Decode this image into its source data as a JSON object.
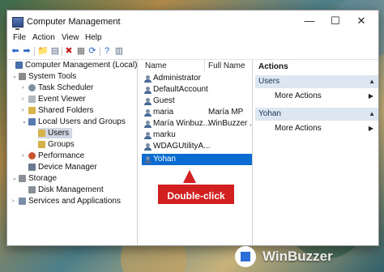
{
  "window": {
    "title": "Computer Management",
    "controls": {
      "minimize": "—",
      "maximize": "☐",
      "close": "✕"
    }
  },
  "menu": [
    "File",
    "Action",
    "View",
    "Help"
  ],
  "toolbar": [
    "⬅",
    "➡",
    "📁",
    "▤",
    "✖",
    "▦",
    "⟳",
    "?",
    "▥"
  ],
  "tree_expand": {
    "expanded": "⌄",
    "collapsed": "›"
  },
  "tree": [
    "Computer Management (Local)",
    "System Tools",
    "Task Scheduler",
    "Event Viewer",
    "Shared Folders",
    "Local Users and Groups",
    "Users",
    "Groups",
    "Performance",
    "Device Manager",
    "Storage",
    "Disk Management",
    "Services and Applications"
  ],
  "list": {
    "columns": [
      "Name",
      "Full Name"
    ],
    "rows": [
      {
        "name": "Administrator",
        "full": ""
      },
      {
        "name": "DefaultAccount",
        "full": ""
      },
      {
        "name": "Guest",
        "full": ""
      },
      {
        "name": "maria",
        "full": "María MP"
      },
      {
        "name": "María Winbuz...",
        "full": "WinBuzzer ..."
      },
      {
        "name": "marku",
        "full": ""
      },
      {
        "name": "WDAGUtilityA...",
        "full": ""
      },
      {
        "name": "Yohan",
        "full": ""
      }
    ],
    "selected": "Yohan"
  },
  "actions": {
    "header": "Actions",
    "collapse_glyph": "▲",
    "more_glyph": "▶",
    "sections": [
      {
        "title": "Users",
        "item": "More Actions"
      },
      {
        "title": "Yohan",
        "item": "More Actions"
      }
    ]
  },
  "callout": {
    "text": "Double-click"
  },
  "watermark": {
    "text": "WinBuzzer"
  },
  "colors": {
    "selection": "#0a6cd0",
    "section_bg": "#dde7f2",
    "callout": "#d21f1f"
  }
}
